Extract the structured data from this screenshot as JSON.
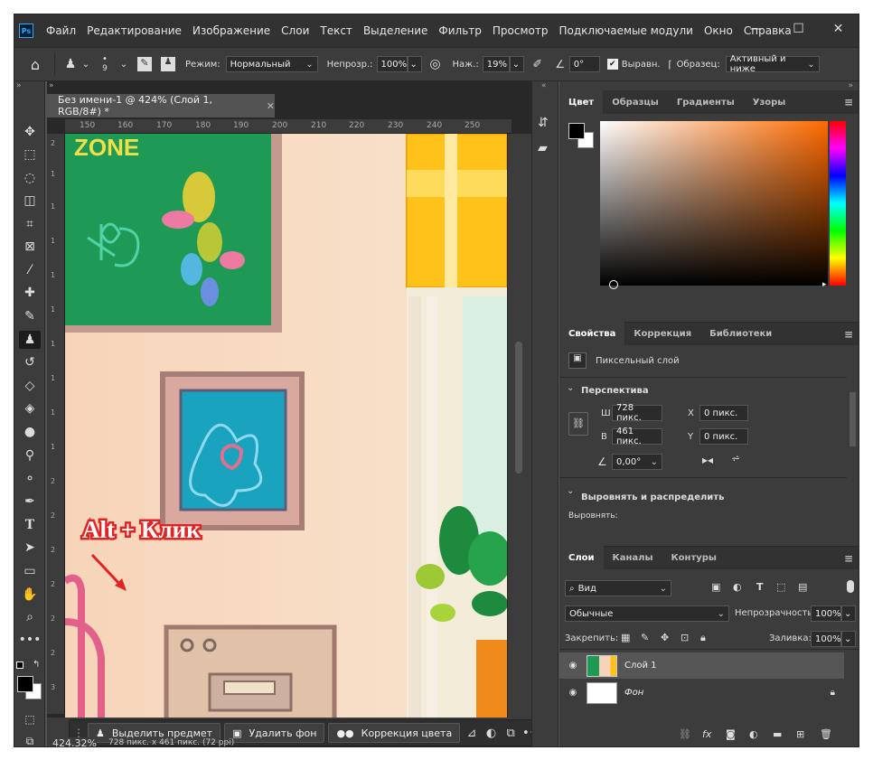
{
  "menu": {
    "items": [
      "Файл",
      "Редактирование",
      "Изображение",
      "Слои",
      "Текст",
      "Выделение",
      "Фильтр",
      "Просмотр",
      "Подключаемые модули",
      "Окно",
      "Справка"
    ],
    "logo": "Ps"
  },
  "options": {
    "brush_size": "9",
    "mode_label": "Режим:",
    "mode_value": "Нормальный",
    "opacity_label": "Непрозр.:",
    "opacity_value": "100%",
    "pressure_label": "Наж.:",
    "pressure_value": "19%",
    "angle_value": "0°",
    "aligned_label": "Выравн.",
    "sample_label": "Образец:",
    "sample_value": "Активный и ниже"
  },
  "document": {
    "tab_title": "Без имени-1 @ 424% (Слой 1, RGB/8#) *",
    "ruler_h": [
      "150",
      "160",
      "170",
      "180",
      "190",
      "200",
      "210",
      "220",
      "230",
      "240",
      "250"
    ],
    "ruler_v": [
      "2",
      "1",
      "1",
      "1",
      "1",
      "1",
      "1",
      "1",
      "1",
      "1",
      "2",
      "2",
      "2",
      "2",
      "2",
      "2",
      "3"
    ],
    "annotation": "Alt + Клик",
    "zoom": "424,32%",
    "doc_info": "728 пикс. x 461 пикс. (72 ppi)"
  },
  "context_bar": {
    "select_subject": "Выделить предмет",
    "remove_bg": "Удалить фон",
    "color_correction": "Коррекция цвета"
  },
  "color_panel": {
    "tabs": [
      "Цвет",
      "Образцы",
      "Градиенты",
      "Узоры"
    ]
  },
  "properties_panel": {
    "tabs": [
      "Свойства",
      "Коррекция",
      "Библиотеки"
    ],
    "layer_type": "Пиксельный слой",
    "section_perspective": "Перспектива",
    "w_label": "Ш",
    "w_value": "728 пикс.",
    "h_label": "В",
    "h_value": "461 пикс.",
    "x_label": "X",
    "x_value": "0 пикс.",
    "y_label": "Y",
    "y_value": "0 пикс.",
    "angle_value": "0,00°",
    "section_align": "Выровнять и распределить",
    "align_label": "Выровнять:"
  },
  "layers_panel": {
    "tabs": [
      "Слои",
      "Каналы",
      "Контуры"
    ],
    "filter_kind": "Вид",
    "blend_mode": "Обычные",
    "opacity_label": "Непрозрачность:",
    "opacity_value": "100%",
    "lock_label": "Закрепить:",
    "fill_label": "Заливка:",
    "fill_value": "100%",
    "layers": [
      {
        "name": "Слой 1"
      },
      {
        "name": "Фон"
      }
    ]
  },
  "colors": {
    "accent": "#31a8ff",
    "fg": "#000000",
    "bg": "#ffffff",
    "annotation_red": "#e02424"
  }
}
